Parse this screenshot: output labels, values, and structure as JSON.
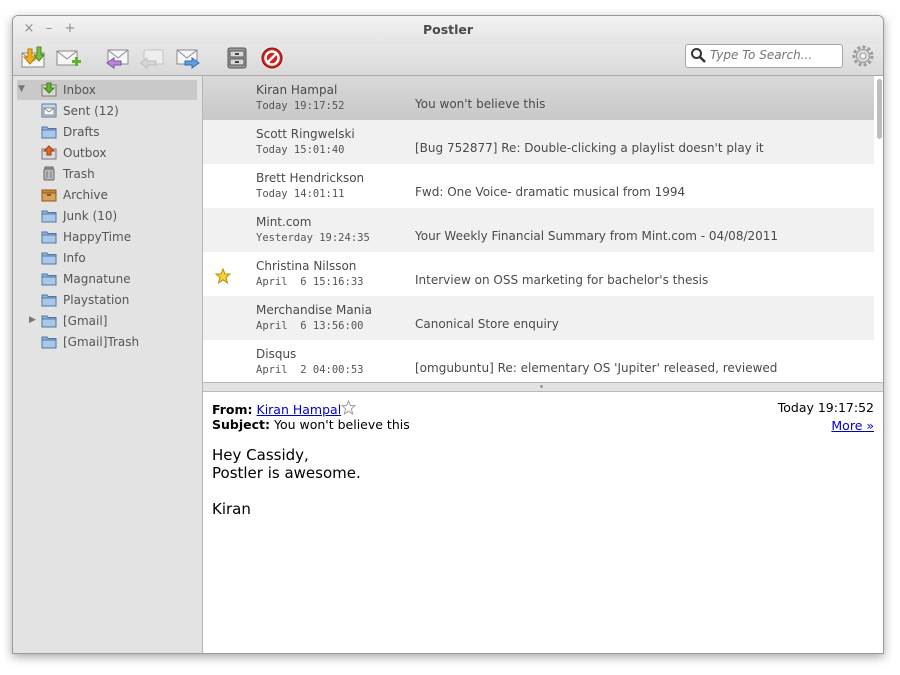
{
  "window": {
    "title": "Postler",
    "controls": {
      "close": "×",
      "minimize": "–",
      "maximize": "+"
    }
  },
  "toolbar": {
    "buttons": [
      {
        "name": "receive-mail-icon"
      },
      {
        "name": "compose-icon"
      },
      {
        "name": "reply-icon"
      },
      {
        "name": "reply-all-icon"
      },
      {
        "name": "forward-icon"
      },
      {
        "name": "archive-icon"
      },
      {
        "name": "delete-icon"
      }
    ],
    "search": {
      "placeholder": "Type To Search..."
    }
  },
  "folders": [
    {
      "label": "Inbox",
      "icon": "inbox-icon",
      "expanded": true
    },
    {
      "label": "Sent (12)",
      "icon": "sent-icon"
    },
    {
      "label": "Drafts",
      "icon": "folder-icon"
    },
    {
      "label": "Outbox",
      "icon": "outbox-icon"
    },
    {
      "label": "Trash",
      "icon": "trash-icon"
    },
    {
      "label": "Archive",
      "icon": "archive-box-icon"
    },
    {
      "label": "Junk (10)",
      "icon": "folder-icon"
    },
    {
      "label": "HappyTime",
      "icon": "folder-icon"
    },
    {
      "label": "Info",
      "icon": "folder-icon"
    },
    {
      "label": "Magnatune",
      "icon": "folder-icon"
    },
    {
      "label": "Playstation",
      "icon": "folder-icon"
    },
    {
      "label": "[Gmail]",
      "icon": "folder-icon",
      "collapsed": true
    },
    {
      "label": "[Gmail]Trash",
      "icon": "folder-icon"
    }
  ],
  "messages": [
    {
      "from": "Kiran Hampal",
      "date": "Today 19:17:52",
      "subject": "You won't believe this",
      "starred": false,
      "selected": true
    },
    {
      "from": "Scott Ringwelski",
      "date": "Today 15:01:40",
      "subject": "[Bug 752877] Re: Double-clicking a playlist doesn't play it",
      "starred": false
    },
    {
      "from": "Brett Hendrickson",
      "date": "Today 14:01:11",
      "subject": "Fwd: One Voice- dramatic musical from 1994",
      "starred": false
    },
    {
      "from": "Mint.com",
      "date": "Yesterday 19:24:35",
      "subject": "Your Weekly Financial Summary from Mint.com - 04/08/2011",
      "starred": false
    },
    {
      "from": "Christina Nilsson",
      "date": "April  6 15:16:33",
      "subject": "Interview on OSS marketing for bachelor's thesis",
      "starred": true
    },
    {
      "from": "Merchandise Mania",
      "date": "April  6 13:56:00",
      "subject": "Canonical Store enquiry",
      "starred": false
    },
    {
      "from": "Disqus",
      "date": "April  2 04:00:53",
      "subject": "[omgubuntu] Re: elementary OS 'Jupiter' released, reviewed",
      "starred": false
    }
  ],
  "reader": {
    "from_label": "From:",
    "from_name": "Kiran Hampal",
    "subject_label": "Subject:",
    "subject": "You won't believe this",
    "date": "Today 19:17:52",
    "more": "More »",
    "body": "Hey Cassidy,\nPostler is awesome.\n\nKiran"
  },
  "colors": {
    "link": "#0000cc",
    "star": "#e8c21a",
    "sidebar": "#e3e3e3"
  }
}
